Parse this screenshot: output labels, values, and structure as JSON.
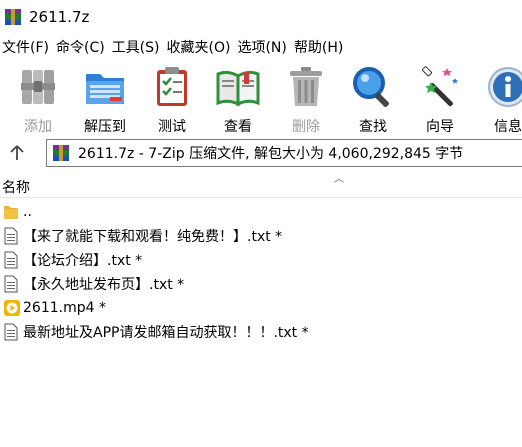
{
  "window": {
    "title": "2611.7z"
  },
  "menu": [
    "文件(F)",
    "命令(C)",
    "工具(S)",
    "收藏夹(O)",
    "选项(N)",
    "帮助(H)"
  ],
  "toolbar": {
    "add": "添加",
    "extract": "解压到",
    "test": "测试",
    "view": "查看",
    "delete": "删除",
    "find": "查找",
    "wizard": "向导",
    "info": "信息"
  },
  "address": {
    "text": "2611.7z - 7-Zip 压缩文件, 解包大小为 4,060,292,845 字节"
  },
  "list": {
    "column_name": "名称",
    "rows": [
      {
        "name": "..",
        "icon": "folder-icon"
      },
      {
        "name": "【来了就能下载和观看！纯免费！】.txt *",
        "icon": "text-file-icon"
      },
      {
        "name": "【论坛介绍】.txt *",
        "icon": "text-file-icon"
      },
      {
        "name": "【永久地址发布页】.txt *",
        "icon": "text-file-icon"
      },
      {
        "name": "2611.mp4 *",
        "icon": "video-file-icon"
      },
      {
        "name": "最新地址及APP请发邮箱自动获取！！！.txt *",
        "icon": "text-file-icon"
      }
    ]
  },
  "colors": {
    "folder": "#f4c242",
    "video": "#f2b400",
    "accent": "#1c6fd1"
  }
}
